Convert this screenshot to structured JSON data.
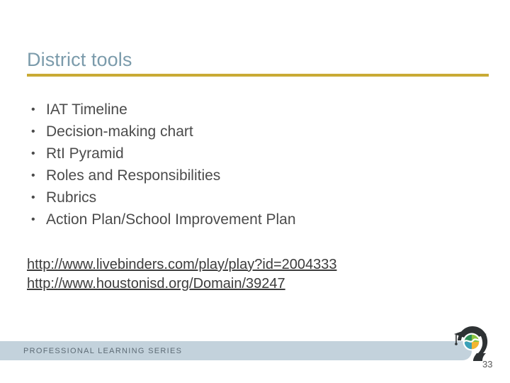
{
  "slide": {
    "title": "District tools",
    "accent_rule_color": "#c9aa35",
    "title_color": "#7b9bab"
  },
  "bullets": [
    {
      "text": "IAT Timeline",
      "marker": "•"
    },
    {
      "text": "Decision-making chart",
      "marker": "•"
    },
    {
      "text": "RtI Pyramid",
      "marker": "•"
    },
    {
      "text": "Roles and Responsibilities",
      "marker": "•"
    },
    {
      "text": "Rubrics",
      "marker": "•"
    },
    {
      "text": "Action Plan/School Improvement Plan",
      "marker": "•"
    }
  ],
  "links": [
    {
      "text": "http://www.livebinders.com/play/play?id=2004333"
    },
    {
      "text": "http://www.houstonisd.org/Domain/39247"
    }
  ],
  "footer": {
    "label": "PROFESSIONAL LEARNING SERIES",
    "bar_color": "#c3d2dc",
    "label_color": "#5d6b75",
    "logo_name": "professional-learning-series-logo"
  },
  "page_number": "33"
}
